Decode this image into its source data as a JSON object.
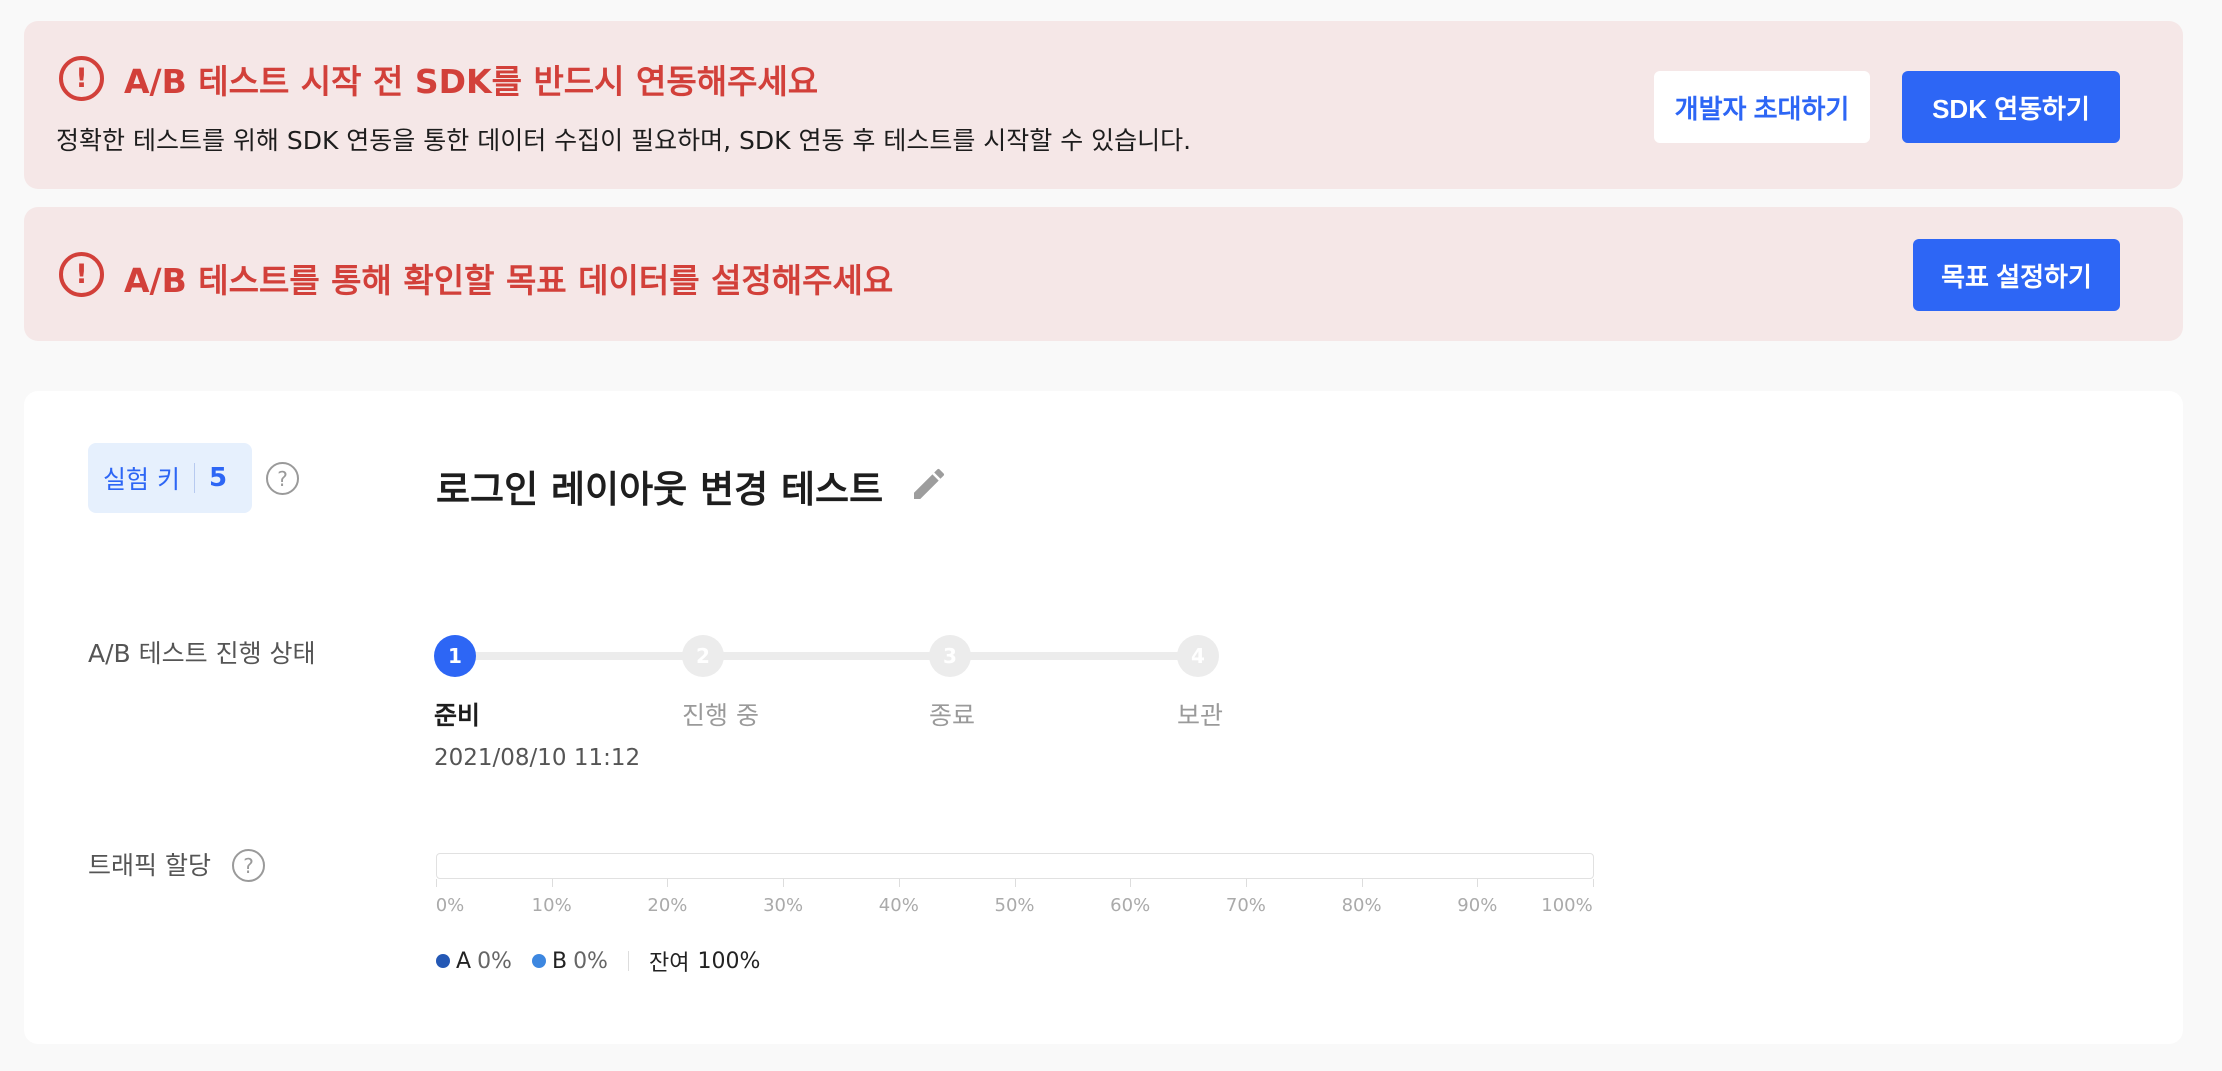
{
  "alerts": {
    "sdk": {
      "title": "A/B 테스트 시작 전 SDK를 반드시 연동해주세요",
      "description": "정확한 테스트를 위해 SDK 연동을 통한 데이터 수집이 필요하며, SDK 연동 후 테스트를 시작할 수 있습니다.",
      "invite_button": "개발자 초대하기",
      "connect_button": "SDK 연동하기"
    },
    "goal": {
      "title": "A/B 테스트를 통해 확인할 목표 데이터를 설정해주세요",
      "goal_button": "목표 설정하기"
    },
    "icon_symbol": "!"
  },
  "experiment": {
    "key_label": "실험 키",
    "key_value": "5",
    "title": "로그인 레이아웃 변경 테스트",
    "help_symbol": "?"
  },
  "status": {
    "label": "A/B 테스트 진행 상태",
    "steps": [
      {
        "number": "1",
        "label": "준비"
      },
      {
        "number": "2",
        "label": "진행 중"
      },
      {
        "number": "3",
        "label": "종료"
      },
      {
        "number": "4",
        "label": "보관"
      }
    ],
    "active_index": 0,
    "date": "2021/08/10 11:12"
  },
  "traffic": {
    "label": "트래픽 할당",
    "ticks": [
      "0%",
      "10%",
      "20%",
      "30%",
      "40%",
      "50%",
      "60%",
      "70%",
      "80%",
      "90%",
      "100%"
    ],
    "legend": {
      "a_label": "A",
      "a_value": "0%",
      "b_label": "B",
      "b_value": "0%",
      "remaining_label": "잔여",
      "remaining_value": "100%"
    },
    "allocation_percent": {
      "A": 0,
      "B": 0,
      "remaining": 100
    }
  },
  "colors": {
    "accent": "#2d66f5",
    "alert_red": "#d2403a",
    "alert_bg": "#f5e7e7",
    "series_a": "#2458b5",
    "series_b": "#3d87e0"
  }
}
